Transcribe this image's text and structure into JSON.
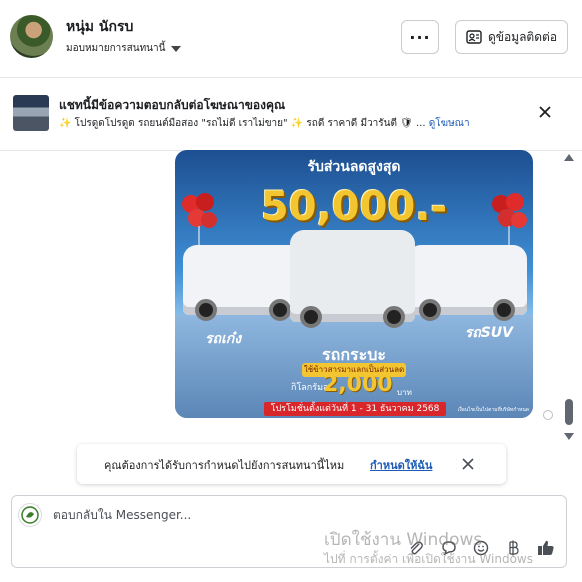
{
  "header": {
    "contact_name": "หนุ่ม นักรบ",
    "assign_label": "มอบหมายการสนทนานี้",
    "more_label": "···",
    "contact_info_label": "ดูข้อมูลติดต่อ"
  },
  "ad_banner": {
    "title": "แชทนี้มีข้อความตอบกลับต่อโฆษณาของคุณ",
    "description": "✨ โปรดูดโปรดูด รถยนต์มือสอง \"รถไม่ดี เราไม่ขาย\" ✨ รถดี ราคาดี มีวารันตี 🛡 ...",
    "link_label": "ดูโฆษณา"
  },
  "promo": {
    "headline": "รับส่วนลดสูงสุด",
    "amount": "50,000.-",
    "label_left": "รถเก๋ง",
    "label_center": "รถกระบะ",
    "label_right": "รถSUV",
    "trade_in": "ใช้ข้าวสารมาแลกเป็นส่วนลด",
    "per_kg": "กิโลกรัมละ",
    "price": "2,000",
    "baht": "บาท",
    "date_range": "โปรโมชั่นตั้งแต่วันที่ 1 - 31 ธันวาคม 2568",
    "note": "เงื่อนไขเป็นไปตามที่บริษัทกำหนด"
  },
  "assign_prompt": {
    "text": "คุณต้องการได้รับการกำหนดไปยังการสนทนานี้ไหม",
    "action": "กำหนดให้ฉัน"
  },
  "composer": {
    "placeholder": "ตอบกลับใน Messenger..."
  },
  "watermark": {
    "line1": "เปิดใช้งาน Windows",
    "line2": "ไปที่ การตั้งค่า เพื่อเปิดใช้งาน Windows"
  },
  "icons": [
    "gear-icon",
    "more-icon",
    "contact-card-icon",
    "close-icon",
    "attach-icon",
    "chat-bubble-icon",
    "emoji-icon",
    "baht-icon",
    "like-icon"
  ],
  "colors": {
    "link": "#1d5bb6",
    "border": "#ccd0d5",
    "accent_gold": "#f3c531"
  }
}
